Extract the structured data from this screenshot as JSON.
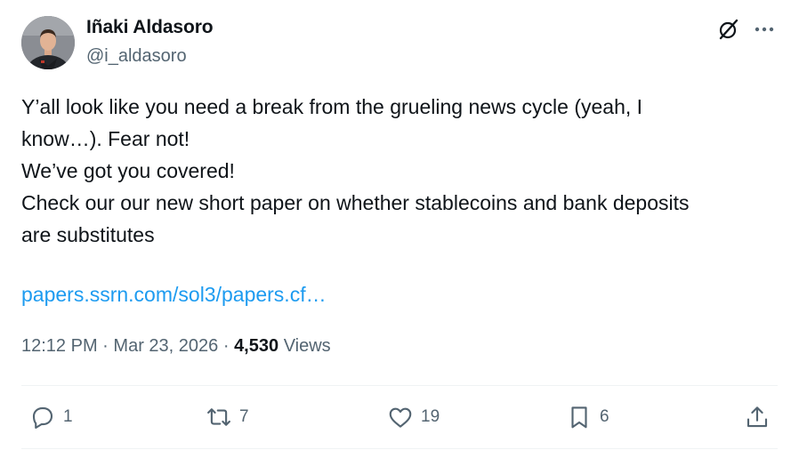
{
  "author": {
    "display_name": "Iñaki Aldasoro",
    "handle": "@i_aldasoro"
  },
  "header_icons": [
    "grok-icon",
    "more-icon"
  ],
  "tweet": {
    "lines": [
      "Y’all look like you need a break from the grueling news cycle (yeah, I",
      "know…). Fear not!",
      "We’ve got you covered!",
      "Check our our new short paper on whether stablecoins and bank deposits",
      "are substitutes"
    ],
    "link_text": "papers.ssrn.com/sol3/papers.cf…"
  },
  "meta": {
    "time": "12:12 PM",
    "separator": "·",
    "date": "Mar 23, 2026",
    "views_count": "4,530",
    "views_label": "Views"
  },
  "actions": {
    "reply": {
      "icon": "reply-icon",
      "count": "1"
    },
    "repost": {
      "icon": "repost-icon",
      "count": "7"
    },
    "like": {
      "icon": "heart-icon",
      "count": "19"
    },
    "bookmark": {
      "icon": "bookmark-icon",
      "count": "6"
    },
    "share": {
      "icon": "share-icon"
    }
  },
  "colors": {
    "text": "#0f1419",
    "secondary": "#536471",
    "link": "#1d9bf0",
    "divider": "#eff3f4"
  }
}
